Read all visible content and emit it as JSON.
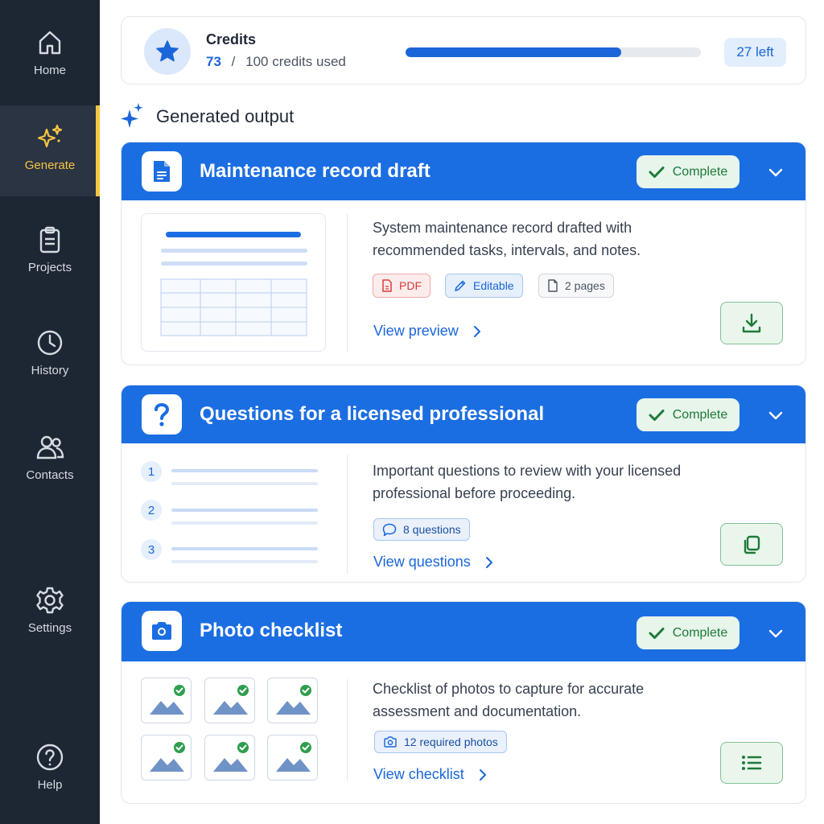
{
  "sidebar": {
    "items": [
      {
        "label": "Home",
        "icon": "home-icon"
      },
      {
        "label": "Generate",
        "icon": "sparkles-icon",
        "active": true
      },
      {
        "label": "Projects",
        "icon": "clipboard-icon"
      },
      {
        "label": "History",
        "icon": "clock-icon"
      },
      {
        "label": "Contacts",
        "icon": "users-icon"
      },
      {
        "label": "Settings",
        "icon": "gear-icon"
      },
      {
        "label": "Help",
        "icon": "help-icon"
      }
    ]
  },
  "credits": {
    "title": "Credits",
    "used": "73",
    "separator": "/",
    "total_text": "100 credits used",
    "used_fraction": 0.73,
    "left_label": "27 left"
  },
  "section": {
    "title": "Generated output"
  },
  "cards": [
    {
      "title": "Maintenance record draft",
      "icon": "document-icon",
      "status": "Complete",
      "description": "System maintenance record drafted with recommended tasks, intervals, and notes.",
      "tags": [
        "PDF",
        "Editable",
        "2 pages"
      ],
      "link": "View preview",
      "action_icon": "download-icon"
    },
    {
      "title": "Questions for a licensed professional",
      "icon": "question-icon",
      "status": "Complete",
      "description": "Important questions to review with your licensed professional before proceeding.",
      "list_numbers": [
        "1",
        "2",
        "3"
      ],
      "tags": [
        "8 questions"
      ],
      "link": "View questions",
      "action_icon": "copy-icon"
    },
    {
      "title": "Photo checklist",
      "icon": "camera-icon",
      "status": "Complete",
      "description": "Checklist of photos to capture for accurate assessment and documentation.",
      "tags": [
        "12 required photos"
      ],
      "link": "View checklist",
      "action_icon": "list-icon"
    }
  ],
  "colors": {
    "sidebar_bg": "#1d2633",
    "accent_yellow": "#f5c542",
    "primary_blue": "#1b6ee2",
    "success_green": "#1e7a3a"
  }
}
